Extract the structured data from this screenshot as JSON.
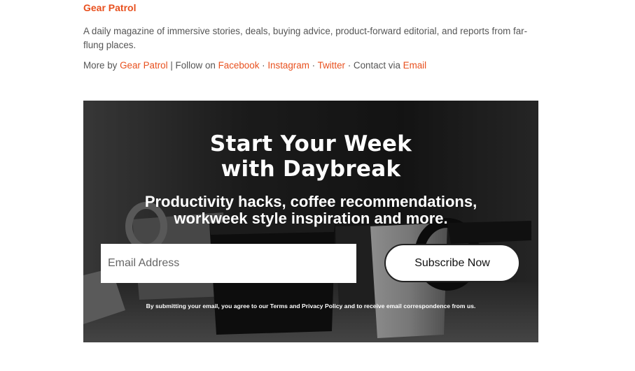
{
  "author": {
    "name": "Gear Patrol",
    "bio": "A daily magazine of immersive stories, deals, buying advice, product-forward editorial, and reports from far-flung places.",
    "more_by_label": "More by",
    "more_by_link": "Gear Patrol",
    "follow_label": "| Follow on",
    "sep": "·",
    "social": [
      "Facebook",
      "Instagram",
      "Twitter"
    ],
    "contact_label": "· Contact via",
    "contact_link": "Email"
  },
  "newsletter": {
    "title_line1": "Start Your Week",
    "title_line2": "with Daybreak",
    "subtitle_line1": "Productivity hacks, coffee recommendations,",
    "subtitle_line2": "workweek style inspiration and more.",
    "email_placeholder": "Email Address",
    "subscribe_label": "Subscribe Now",
    "legal": "By submitting your email, you agree to our Terms and Privacy Policy and to receive email correspondence from us."
  },
  "colors": {
    "accent": "#e8501e",
    "body_text": "#555555",
    "banner_bg": "#2b2b2b"
  }
}
